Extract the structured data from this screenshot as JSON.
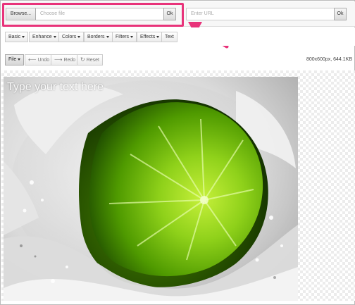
{
  "file_upload": {
    "browse_label": "Browse...",
    "placeholder": "Choose file",
    "ok_label": "Ok"
  },
  "url_input": {
    "placeholder": "Enter URL",
    "ok_label": "Ok"
  },
  "menus": {
    "basic": "Basic",
    "enhance": "Enhance",
    "colors": "Colors",
    "borders": "Borders",
    "filters": "Filters",
    "effects": "Effects",
    "text": "Text"
  },
  "toolbar": {
    "file": "File",
    "undo": "Undo",
    "redo": "Redo",
    "reset": "Reset",
    "image_info": "800x600px, 644.1KB"
  },
  "canvas": {
    "overlay_text": "Type your text here"
  },
  "colors": {
    "highlight": "#e8337a",
    "lime": "#6db300"
  }
}
